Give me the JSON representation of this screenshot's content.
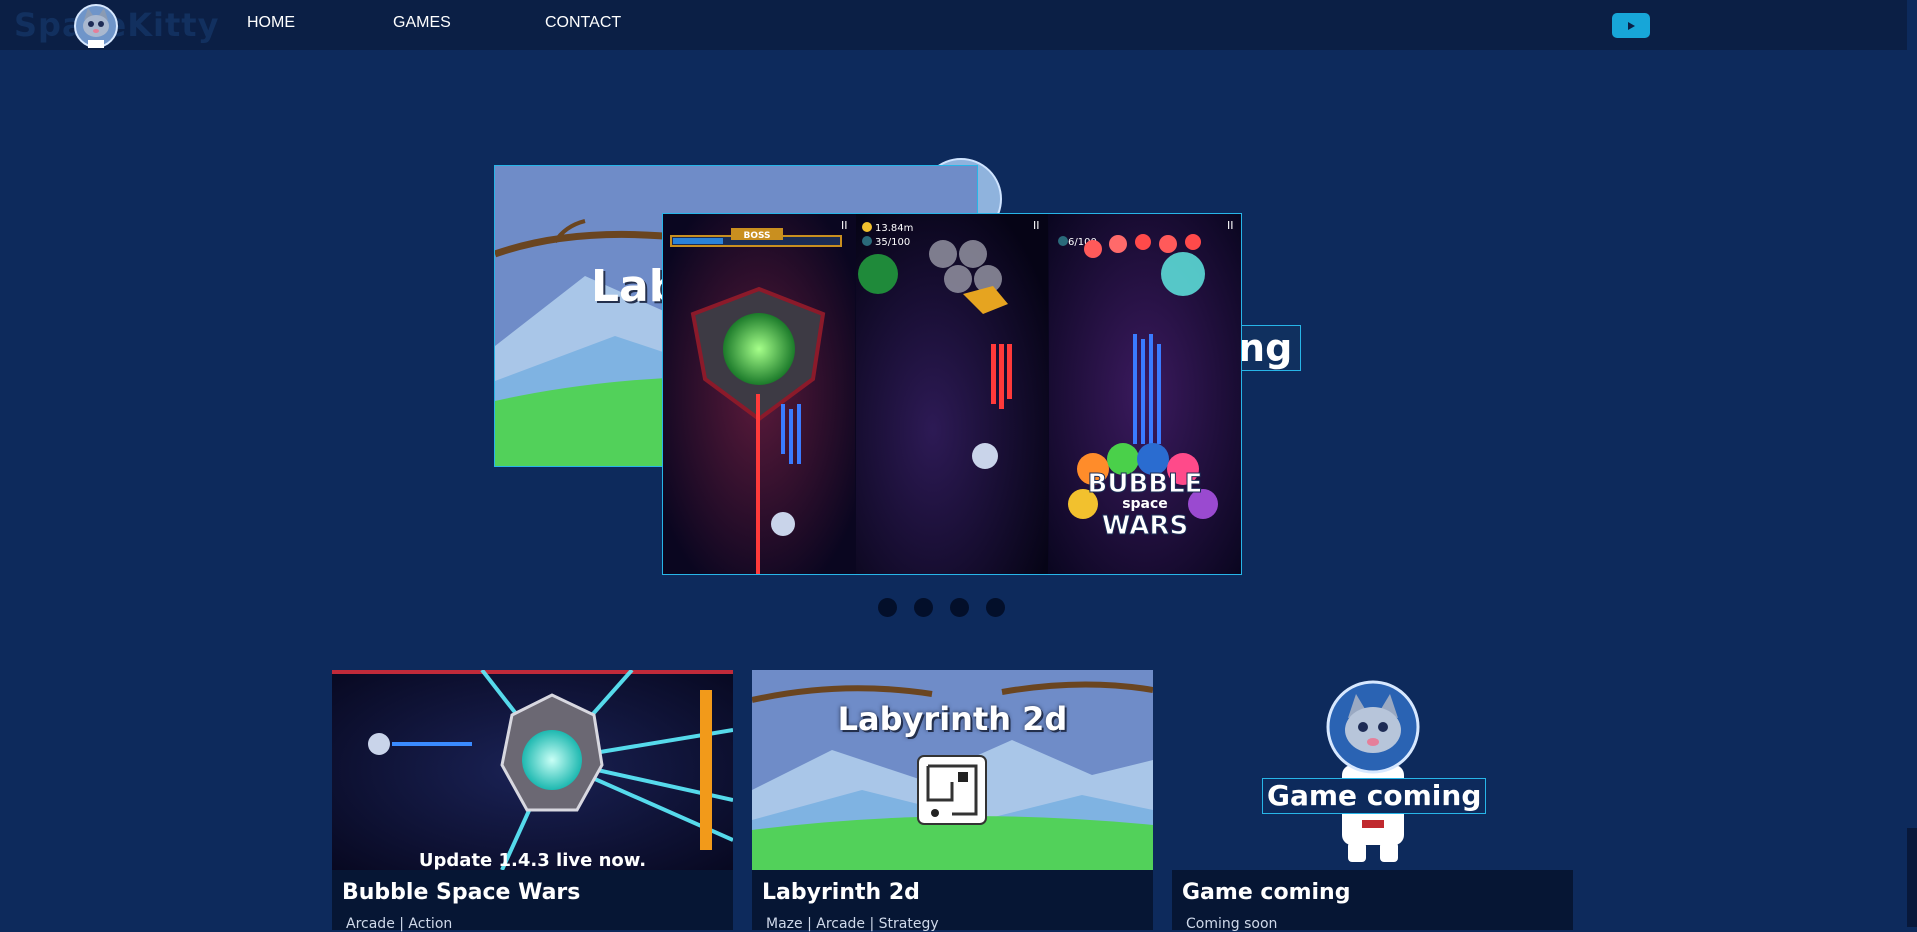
{
  "brand": {
    "name": "SpaceKitty"
  },
  "nav": {
    "items": [
      {
        "label": "HOME"
      },
      {
        "label": "GAMES"
      },
      {
        "label": "CONTACT"
      }
    ],
    "youtube_icon": "play-icon"
  },
  "carousel": {
    "back_slide_title": "Lab",
    "peek_text": "ing",
    "front_slide": {
      "panel1": {
        "boss_label": "BOSS"
      },
      "panel2": {
        "coins": "13.84m",
        "progress": "35/100"
      },
      "panel3": {
        "progress": "6/100",
        "logo_top": "BUBBLE",
        "logo_mid": "space",
        "logo_bottom": "WARS"
      }
    },
    "dot_count": 4
  },
  "cards": [
    {
      "title": "Bubble Space Wars",
      "subtitle": "Arcade | Action",
      "overlay": "Update 1.4.3 live now."
    },
    {
      "title": "Labyrinth 2d",
      "subtitle": "Maze | Arcade | Strategy",
      "overlay": "Labyrinth 2d"
    },
    {
      "title": "Game coming",
      "subtitle": "Coming soon",
      "overlay": "Game coming"
    }
  ],
  "colors": {
    "background": "#0d2a5c",
    "nav": "#0b1f45",
    "accent": "#17a6d8",
    "card_body": "#061634"
  }
}
